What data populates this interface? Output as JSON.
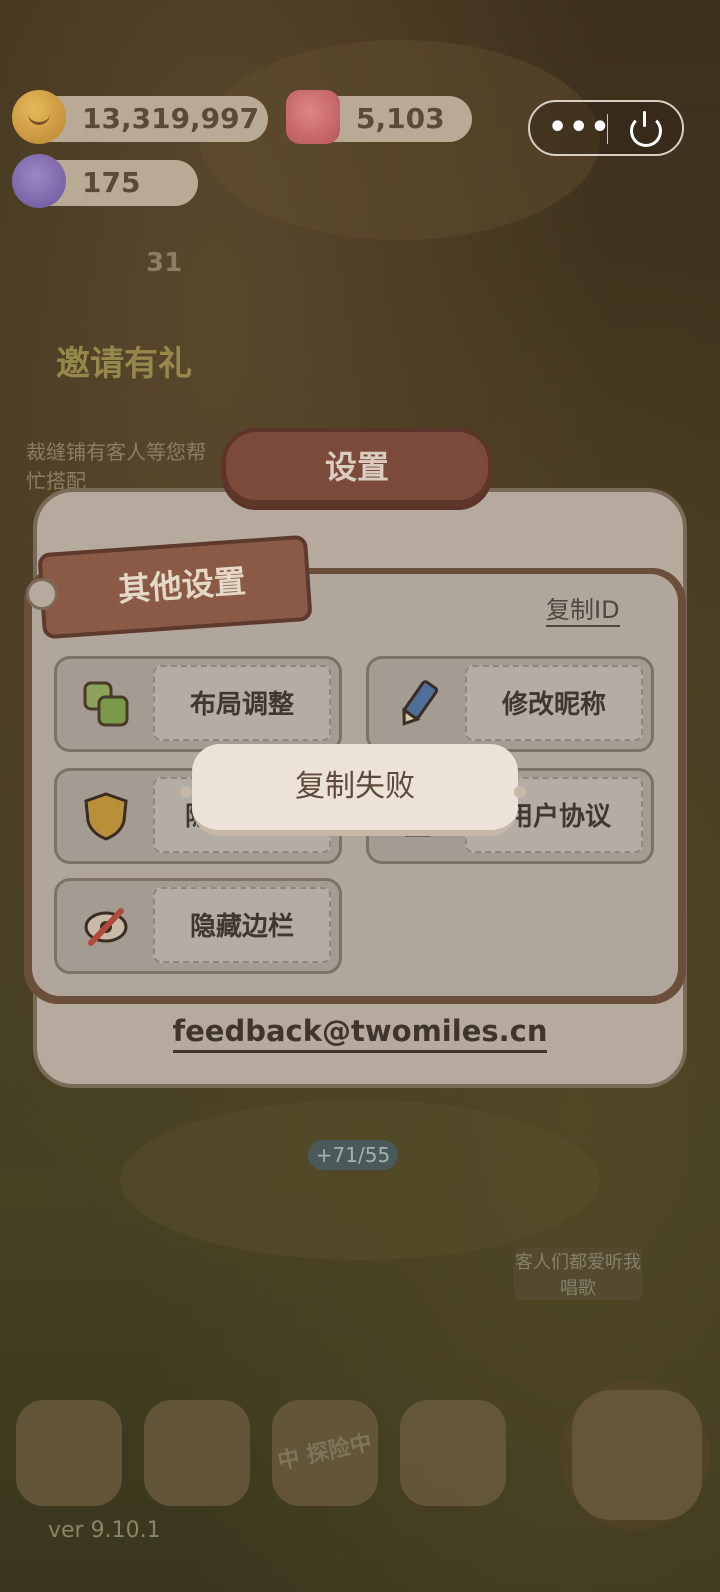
{
  "topbar": {
    "coins": "13,319,997",
    "gems": "5,103",
    "candies": "175",
    "more_label": "•••"
  },
  "background": {
    "level_count": "31",
    "invite_banner": "邀请有礼",
    "notice": "裁缝铺有客人等您帮忙搭配",
    "progress": "+71/55",
    "speech": "客人们都爱听我唱歌",
    "adventure_label": "中 探险中",
    "version": "ver 9.10.1"
  },
  "dialog": {
    "title": "设置",
    "section_tag": "其他设置",
    "copy_id": "复制ID",
    "options": [
      {
        "label": "布局调整",
        "icon": "layout-icon"
      },
      {
        "label": "修改昵称",
        "icon": "pencil-icon"
      },
      {
        "label": "隐",
        "icon": "shield-icon"
      },
      {
        "label": "用户协议",
        "icon": "document-icon"
      },
      {
        "label": "隐藏边栏",
        "icon": "hide-eye-icon"
      }
    ],
    "feedback_email": "feedback@twomiles.cn"
  },
  "toast": {
    "message": "复制失败"
  },
  "colors": {
    "plaque": "#7b4a3b",
    "panel": "#b5aa9d",
    "toast_bg": "#ece2d8"
  }
}
